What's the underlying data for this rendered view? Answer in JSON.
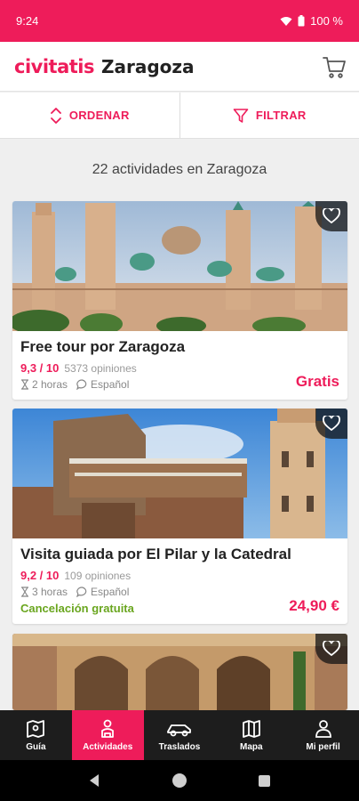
{
  "status_bar": {
    "time": "9:24",
    "battery": "100 %"
  },
  "header": {
    "brand": "civitatis",
    "city": "Zaragoza"
  },
  "toolbar": {
    "sort_label": "ORDENAR",
    "filter_label": "FILTRAR"
  },
  "results": {
    "count_text": "22 actividades en Zaragoza"
  },
  "activities": [
    {
      "title": "Free tour por Zaragoza",
      "score": "9,3 / 10",
      "opinions": "5373 opiniones",
      "duration": "2 horas",
      "language": "Español",
      "cancellation": "",
      "price": "Gratis"
    },
    {
      "title": "Visita guiada por El Pilar y la Catedral",
      "score": "9,2 / 10",
      "opinions": "109 opiniones",
      "duration": "3 horas",
      "language": "Español",
      "cancellation": "Cancelación gratuita",
      "price": "24,90 €"
    }
  ],
  "bottom_nav": [
    {
      "label": "Guía",
      "icon": "map-book-icon"
    },
    {
      "label": "Actividades",
      "icon": "person-icon"
    },
    {
      "label": "Traslados",
      "icon": "car-icon"
    },
    {
      "label": "Mapa",
      "icon": "map-icon"
    },
    {
      "label": "Mi perfil",
      "icon": "profile-icon"
    }
  ],
  "colors": {
    "brand": "#ee1c5a",
    "success": "#6aa61f",
    "nav_bg": "#1d1d1d"
  }
}
